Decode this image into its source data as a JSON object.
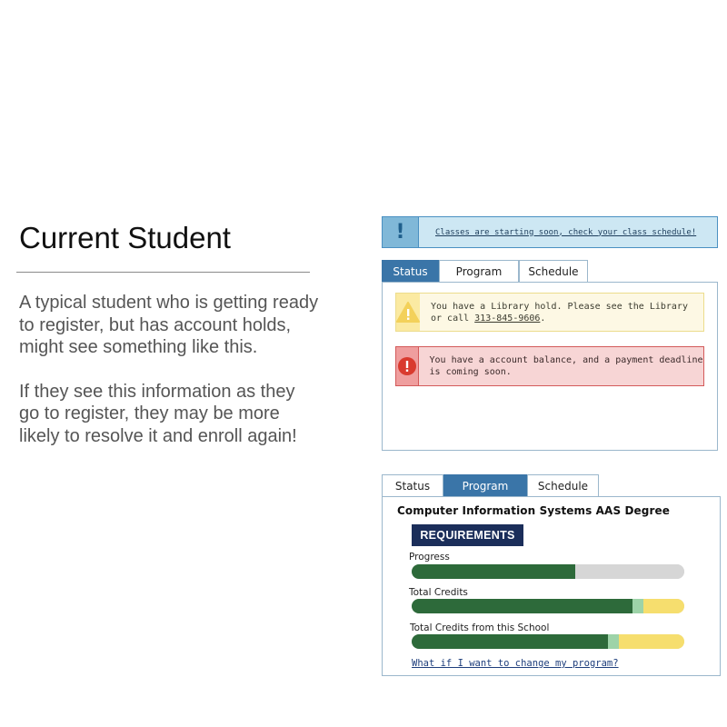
{
  "slide": {
    "title": "Current Student",
    "paragraphs": [
      "A typical student who is getting ready to register, but has account holds, might see something like this.",
      "If they see this information as they go to register, they may be more likely to resolve it and enroll again!"
    ]
  },
  "banner": {
    "icon": "!",
    "message": "Classes are starting soon, check your class schedule!"
  },
  "status_view": {
    "tabs": [
      {
        "label": "Status",
        "active": true
      },
      {
        "label": "Program",
        "active": false
      },
      {
        "label": "Schedule",
        "active": false
      }
    ],
    "alerts": [
      {
        "type": "warning",
        "icon": "!",
        "text_before": "You have a Library hold.  Please see the Library or call ",
        "phone": "313-845-9606",
        "text_after": "."
      },
      {
        "type": "danger",
        "icon": "!",
        "text": "You have a account balance, and a payment deadline is coming soon."
      }
    ]
  },
  "program_view": {
    "tabs": [
      {
        "label": "Status",
        "active": false
      },
      {
        "label": "Program",
        "active": true
      },
      {
        "label": "Schedule",
        "active": false
      }
    ],
    "program_name": "Computer Information Systems AAS Degree",
    "requirements_label": "REQUIREMENTS",
    "bars": [
      {
        "label": "Progress",
        "segments": [
          {
            "color": "#2d6a3a",
            "fraction": 0.6
          },
          {
            "color": "#d6d6d6",
            "fraction": 0.4
          }
        ]
      },
      {
        "label": "Total Credits",
        "segments": [
          {
            "color": "#2d6a3a",
            "fraction": 0.81
          },
          {
            "color": "#9dd3a8",
            "fraction": 0.04
          },
          {
            "color": "#f6de6e",
            "fraction": 0.15
          }
        ]
      },
      {
        "label": "Total Credits from this School",
        "segments": [
          {
            "color": "#2d6a3a",
            "fraction": 0.72
          },
          {
            "color": "#9dd3a8",
            "fraction": 0.04
          },
          {
            "color": "#f6de6e",
            "fraction": 0.24
          }
        ]
      }
    ],
    "change_link": "What if I want to change my program?"
  },
  "colors": {
    "tab_active": "#3a75a8",
    "badge": "#1b2e5a",
    "progress_green": "#2d6a3a"
  }
}
